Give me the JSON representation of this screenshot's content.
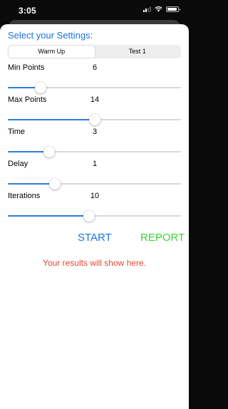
{
  "status_bar": {
    "time": "3:05"
  },
  "screen": {
    "title": "Select your Settings:",
    "tabs": [
      {
        "label": "Warm Up",
        "selected": true
      },
      {
        "label": "Test 1",
        "selected": false
      }
    ],
    "settings": [
      {
        "label": "Min Points",
        "value": "6",
        "slider_fraction": 0.19
      },
      {
        "label": "Max Points",
        "value": "14",
        "slider_fraction": 0.5
      },
      {
        "label": "Time",
        "value": "3",
        "slider_fraction": 0.24
      },
      {
        "label": "Delay",
        "value": "1",
        "slider_fraction": 0.27
      },
      {
        "label": "Iterations",
        "value": "10",
        "slider_fraction": 0.47
      }
    ],
    "start_label": "START",
    "report_label": "REPORT",
    "results_text": "Your results will show here."
  },
  "colors": {
    "accent": "#1a73d9",
    "report": "#3fd43a",
    "results": "#e8442e",
    "slider_fill": "#2f7be0"
  }
}
